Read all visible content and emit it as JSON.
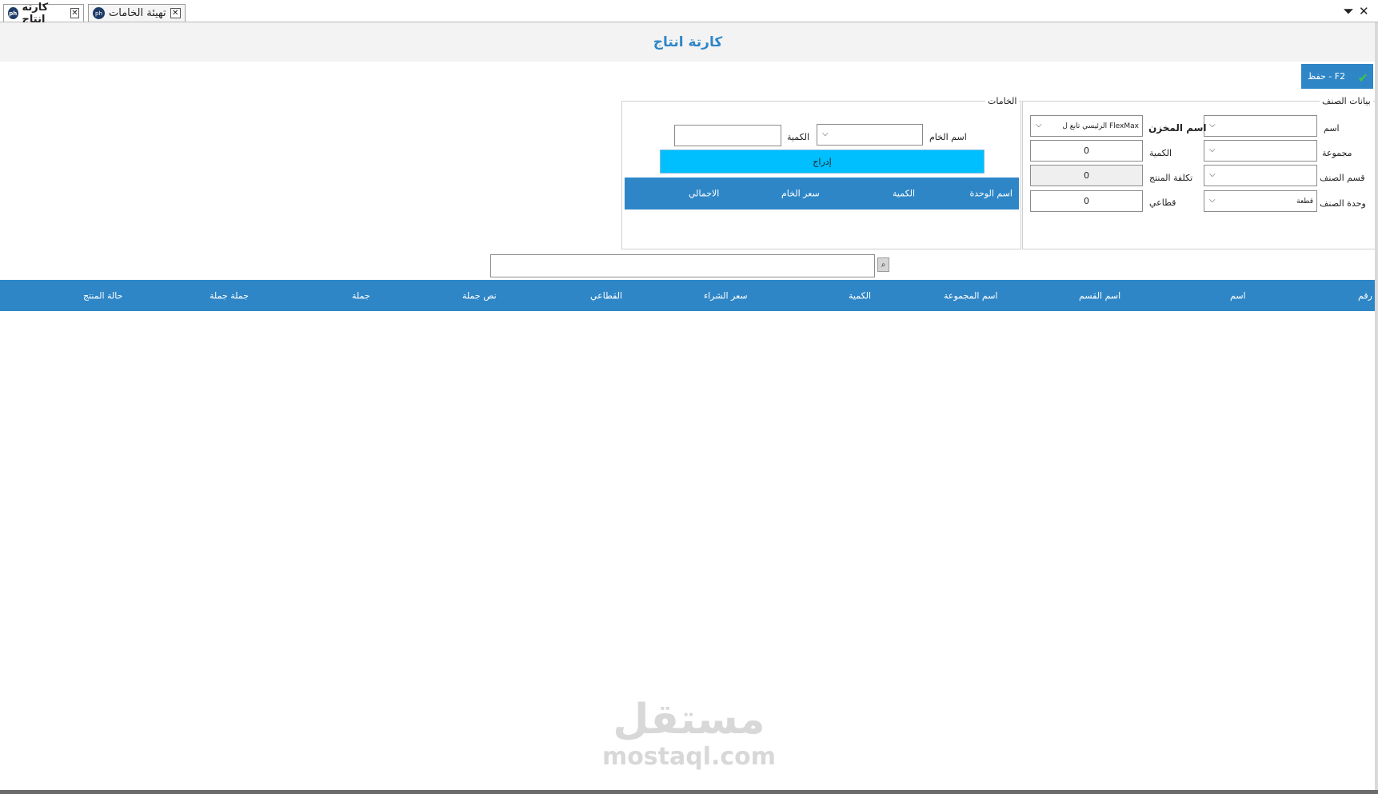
{
  "tabs": [
    {
      "label": "كارته انتاج",
      "active": true
    },
    {
      "label": "تهيئة الخامات",
      "active": false
    }
  ],
  "tab_logo": "ph",
  "window": {
    "dropdown_glyph": "⏷",
    "close_glyph": "✕"
  },
  "title": "كارتة انتاج",
  "save_button": {
    "label": "حفظ - F2",
    "check": "✔"
  },
  "item_group": {
    "legend": "بيانات الصنف",
    "name_label": "اسم",
    "name_value": "",
    "group_label": "مجموعة",
    "group_value": "",
    "section_label": "قسم الصنف",
    "section_value": "",
    "unit_label": "وحدة الصنف",
    "unit_value": "قطعة",
    "store_label": "اسم المخزن",
    "store_value": "الرئيسي تابع ل FlexMax",
    "qty_label": "الكمية",
    "qty_value": "0",
    "cost_label": "تكلفة المنتج",
    "cost_value": "0",
    "retail_label": "قطاعي",
    "retail_value": "0"
  },
  "materials_group": {
    "legend": "الخامات",
    "material_label": "اسم الخام",
    "material_value": "",
    "qty_label": "الكمية",
    "qty_value": "",
    "insert_label": "إدراج",
    "columns": [
      "اسم الوحدة",
      "الكمية",
      "سعر الخام",
      "الاجمالي"
    ]
  },
  "search": {
    "value": "",
    "icon": "⌕"
  },
  "main_grid": {
    "columns": [
      "رقم",
      "اسم",
      "اسم القسم",
      "اسم المجموعة",
      "الكمية",
      "سعر الشراء",
      "القطاعي",
      "نص جملة",
      "جملة",
      "جملة جملة",
      "حالة المنتج"
    ]
  },
  "watermark": {
    "arabic": "مستقل",
    "english": "mostaql.com"
  },
  "combo_arrow": "⌵"
}
